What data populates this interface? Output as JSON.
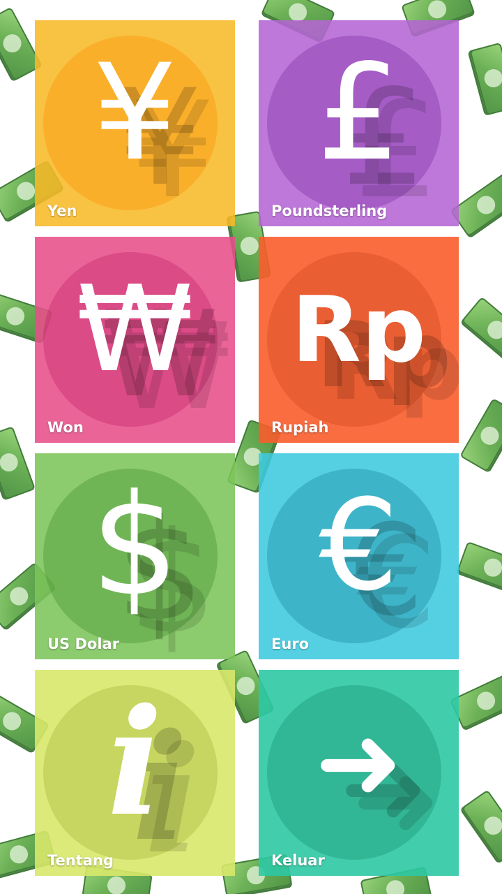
{
  "tiles": [
    {
      "label": "Yen",
      "symbol": "¥",
      "icon": "yen-icon",
      "color": "#f7b928"
    },
    {
      "label": "Poundsterling",
      "symbol": "£",
      "icon": "pound-icon",
      "color": "#b565d4"
    },
    {
      "label": "Won",
      "symbol": "₩",
      "icon": "won-icon",
      "color": "#e84f8a"
    },
    {
      "label": "Rupiah",
      "symbol": "Rp",
      "icon": "rupiah-icon",
      "color": "#f85d2c"
    },
    {
      "label": "US Dolar",
      "symbol": "$",
      "icon": "dollar-icon",
      "color": "#7cc45a"
    },
    {
      "label": "Euro",
      "symbol": "€",
      "icon": "euro-icon",
      "color": "#3ec9df"
    },
    {
      "label": "Tentang",
      "symbol": "i",
      "icon": "info-icon",
      "color": "#d8e86a"
    },
    {
      "label": "Keluar",
      "symbol": "➜",
      "icon": "arrow-right-icon",
      "color": "#2ec9a4"
    }
  ]
}
